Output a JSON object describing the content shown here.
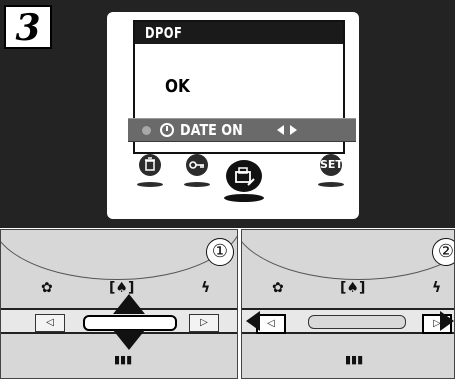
{
  "step": {
    "number": "3"
  },
  "lcd": {
    "title": "DPOF",
    "message": "OK",
    "date_bar": {
      "label": "DATE ON"
    }
  },
  "mode_icons": [
    {
      "name": "erase",
      "glyph": "🗑"
    },
    {
      "name": "protect",
      "glyph": "O-m"
    },
    {
      "name": "dpof",
      "glyph": "⎙"
    },
    {
      "name": "set",
      "glyph": "SET"
    }
  ],
  "panels": [
    {
      "circle_label": "①",
      "top_glyphs": [
        "✿",
        "[♠]",
        "ϟ"
      ],
      "bottom_glyph": "▮▮▮",
      "highlight": "center"
    },
    {
      "circle_label": "②",
      "top_glyphs": [
        "✿",
        "[♠]",
        "ϟ"
      ],
      "bottom_glyph": "▮▮▮",
      "highlight": "sides"
    }
  ],
  "colors": {
    "background_dark": "#232323",
    "panel_gray": "#d7d7d7"
  }
}
